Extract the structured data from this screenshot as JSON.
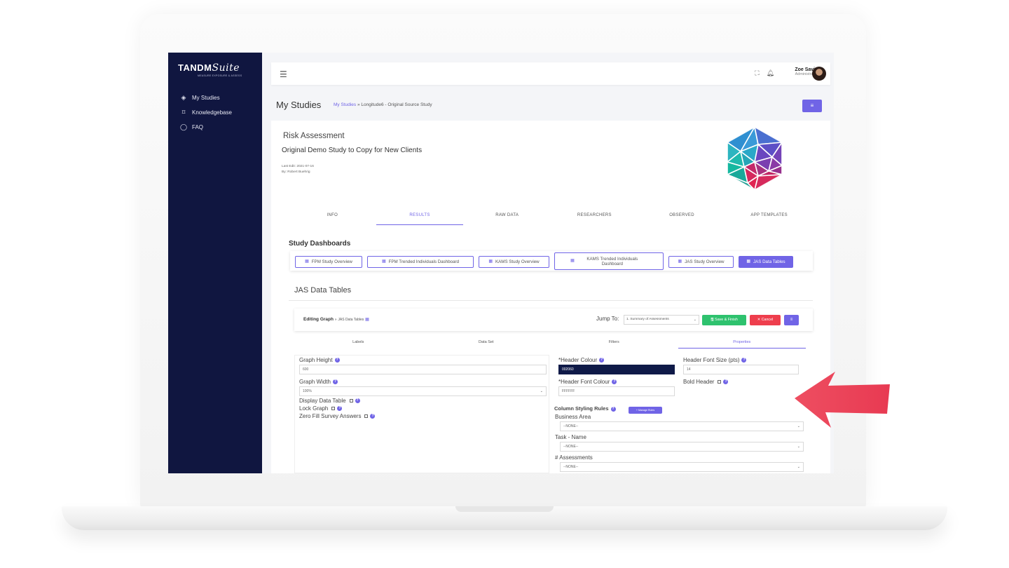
{
  "sidebar": {
    "logo_main": "TANDM",
    "logo_script": "Suite",
    "logo_sub": "MEASURE EXPOSURE & ASSESS",
    "items": [
      {
        "label": "My Studies",
        "icon": "layers-icon"
      },
      {
        "label": "Knowledgebase",
        "icon": "bookmark-icon"
      },
      {
        "label": "FAQ",
        "icon": "chat-bubble-icon"
      }
    ]
  },
  "topbar": {
    "user_name": "Zoe Savic",
    "user_role": "Administrator"
  },
  "header": {
    "page_title": "My Studies",
    "crumb_link": "My Studies",
    "crumb_sep": "»",
    "crumb_current": "Longitude6 - Original Source Study"
  },
  "study": {
    "category": "Risk Assessment",
    "name": "Original Demo Study to Copy for New Clients",
    "last_edit": "Last Edit: 2021-07-16",
    "by": "By: Robert Buehrig"
  },
  "tabs": [
    "INFO",
    "RESULTS",
    "RAW DATA",
    "RESEARCHERS",
    "OBSERVED",
    "APP TEMPLATES"
  ],
  "dashboards": {
    "title": "Study Dashboards",
    "buttons": [
      "FPM Study Overview",
      "FPM Trended Individuals Dashboard",
      "KAMS Study Overview",
      "KAMS Trended Individuals Dashboard",
      "JAS Study Overview",
      "JAS Data Tables"
    ]
  },
  "jas": {
    "title": "JAS Data Tables",
    "editing_label": "Editing Graph",
    "editing_sep": "»",
    "editing_sub": "JAS Data Tables",
    "jump_label": "Jump To:",
    "jump_value": "1. Summary of Assessments",
    "save_label": "Save & Finish",
    "cancel_label": "Cancel",
    "editor_tabs": [
      "Labels",
      "Data Set",
      "Filters",
      "Properties"
    ]
  },
  "properties": {
    "graph_height_label": "Graph Height",
    "graph_height_value": "600",
    "graph_width_label": "Graph Width",
    "graph_width_value": "100%",
    "display_table_label": "Display Data Table",
    "lock_graph_label": "Lock Graph",
    "zero_fill_label": "Zero Fill Survey Answers",
    "header_colour_label": "*Header Colour",
    "header_colour_value": "002060",
    "header_font_colour_label": "*Header Font Colour",
    "header_font_colour_value": "FFFFFF",
    "header_font_size_label": "Header Font Size (pts)",
    "header_font_size_value": "14",
    "bold_header_label": "Bold Header",
    "column_rules_label": "Column Styling Rules",
    "manage_rules_label": "+ Manage Rules",
    "business_area_label": "Business Area",
    "task_name_label": "Task - Name",
    "assessments_label": "# Assessments",
    "none_option": "--NONE--"
  },
  "colors": {
    "sidebar": "#101640",
    "accent": "#7064e6",
    "save": "#2ec26e",
    "cancel": "#ee3e4d",
    "arrow": "#ee4e61"
  }
}
